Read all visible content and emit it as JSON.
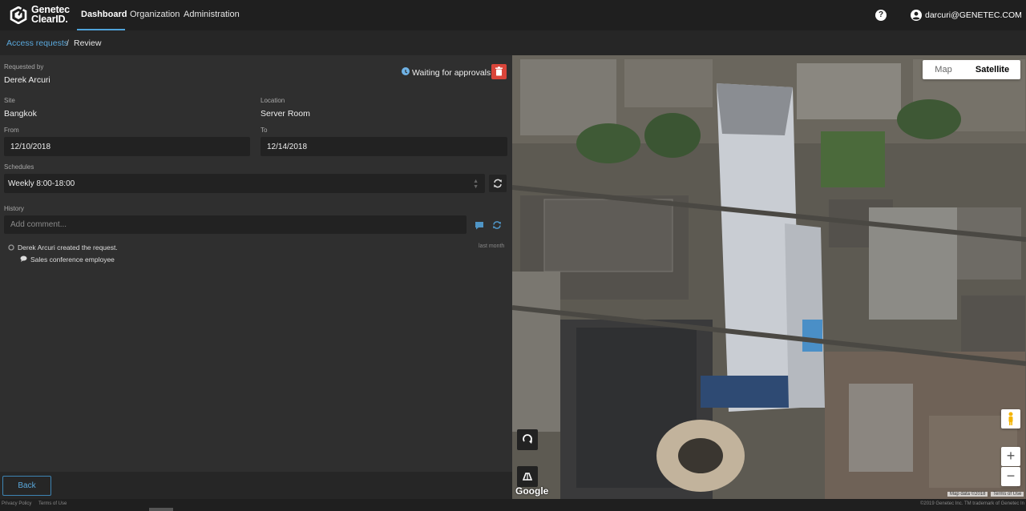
{
  "app": {
    "brand_line1": "Genetec",
    "brand_line2": "ClearID."
  },
  "nav": {
    "items": [
      {
        "label": "Dashboard",
        "active": true
      },
      {
        "label": "Organization",
        "active": false
      },
      {
        "label": "Administration",
        "active": false
      }
    ],
    "help_symbol": "?",
    "user_email": "darcuri@GENETEC.COM"
  },
  "breadcrumb": {
    "link": "Access requests",
    "separator": "/",
    "current": "Review"
  },
  "request": {
    "requested_by_label": "Requested by",
    "requested_by": "Derek Arcuri",
    "status": "Waiting for approvals",
    "site_label": "Site",
    "site": "Bangkok",
    "location_label": "Location",
    "location": "Server Room",
    "from_label": "From",
    "from": "12/10/2018",
    "to_label": "To",
    "to": "12/14/2018",
    "schedules_label": "Schedules",
    "schedule": "Weekly 8:00-18:00"
  },
  "history": {
    "label": "History",
    "comment_placeholder": "Add comment...",
    "entries": [
      {
        "text": "Derek Arcuri created the request.",
        "time": "last month",
        "comment": "Sales conference employee"
      }
    ]
  },
  "actions": {
    "back": "Back"
  },
  "map": {
    "tabs": [
      {
        "label": "Map",
        "active": false
      },
      {
        "label": "Satellite",
        "active": true
      }
    ],
    "zoom_in": "+",
    "zoom_out": "−",
    "google": "Google",
    "attribution": "Map data ©2018",
    "terms": "Terms of Use"
  },
  "footer": {
    "privacy": "Privacy Policy",
    "terms": "Terms of Use",
    "copyright": "©2019 Genetec Inc. TM trademark of Genetec In"
  },
  "colors": {
    "accent": "#4fa3d9",
    "delete": "#d9453a",
    "status_icon": "#6fb2e5"
  },
  "icons": [
    "genetec-logo-icon",
    "help-icon",
    "user-icon",
    "clock-icon",
    "trash-icon",
    "refresh-icon",
    "comment-icon",
    "chevron-down-icon",
    "pegman-icon",
    "rotate-icon",
    "tilt-icon"
  ]
}
